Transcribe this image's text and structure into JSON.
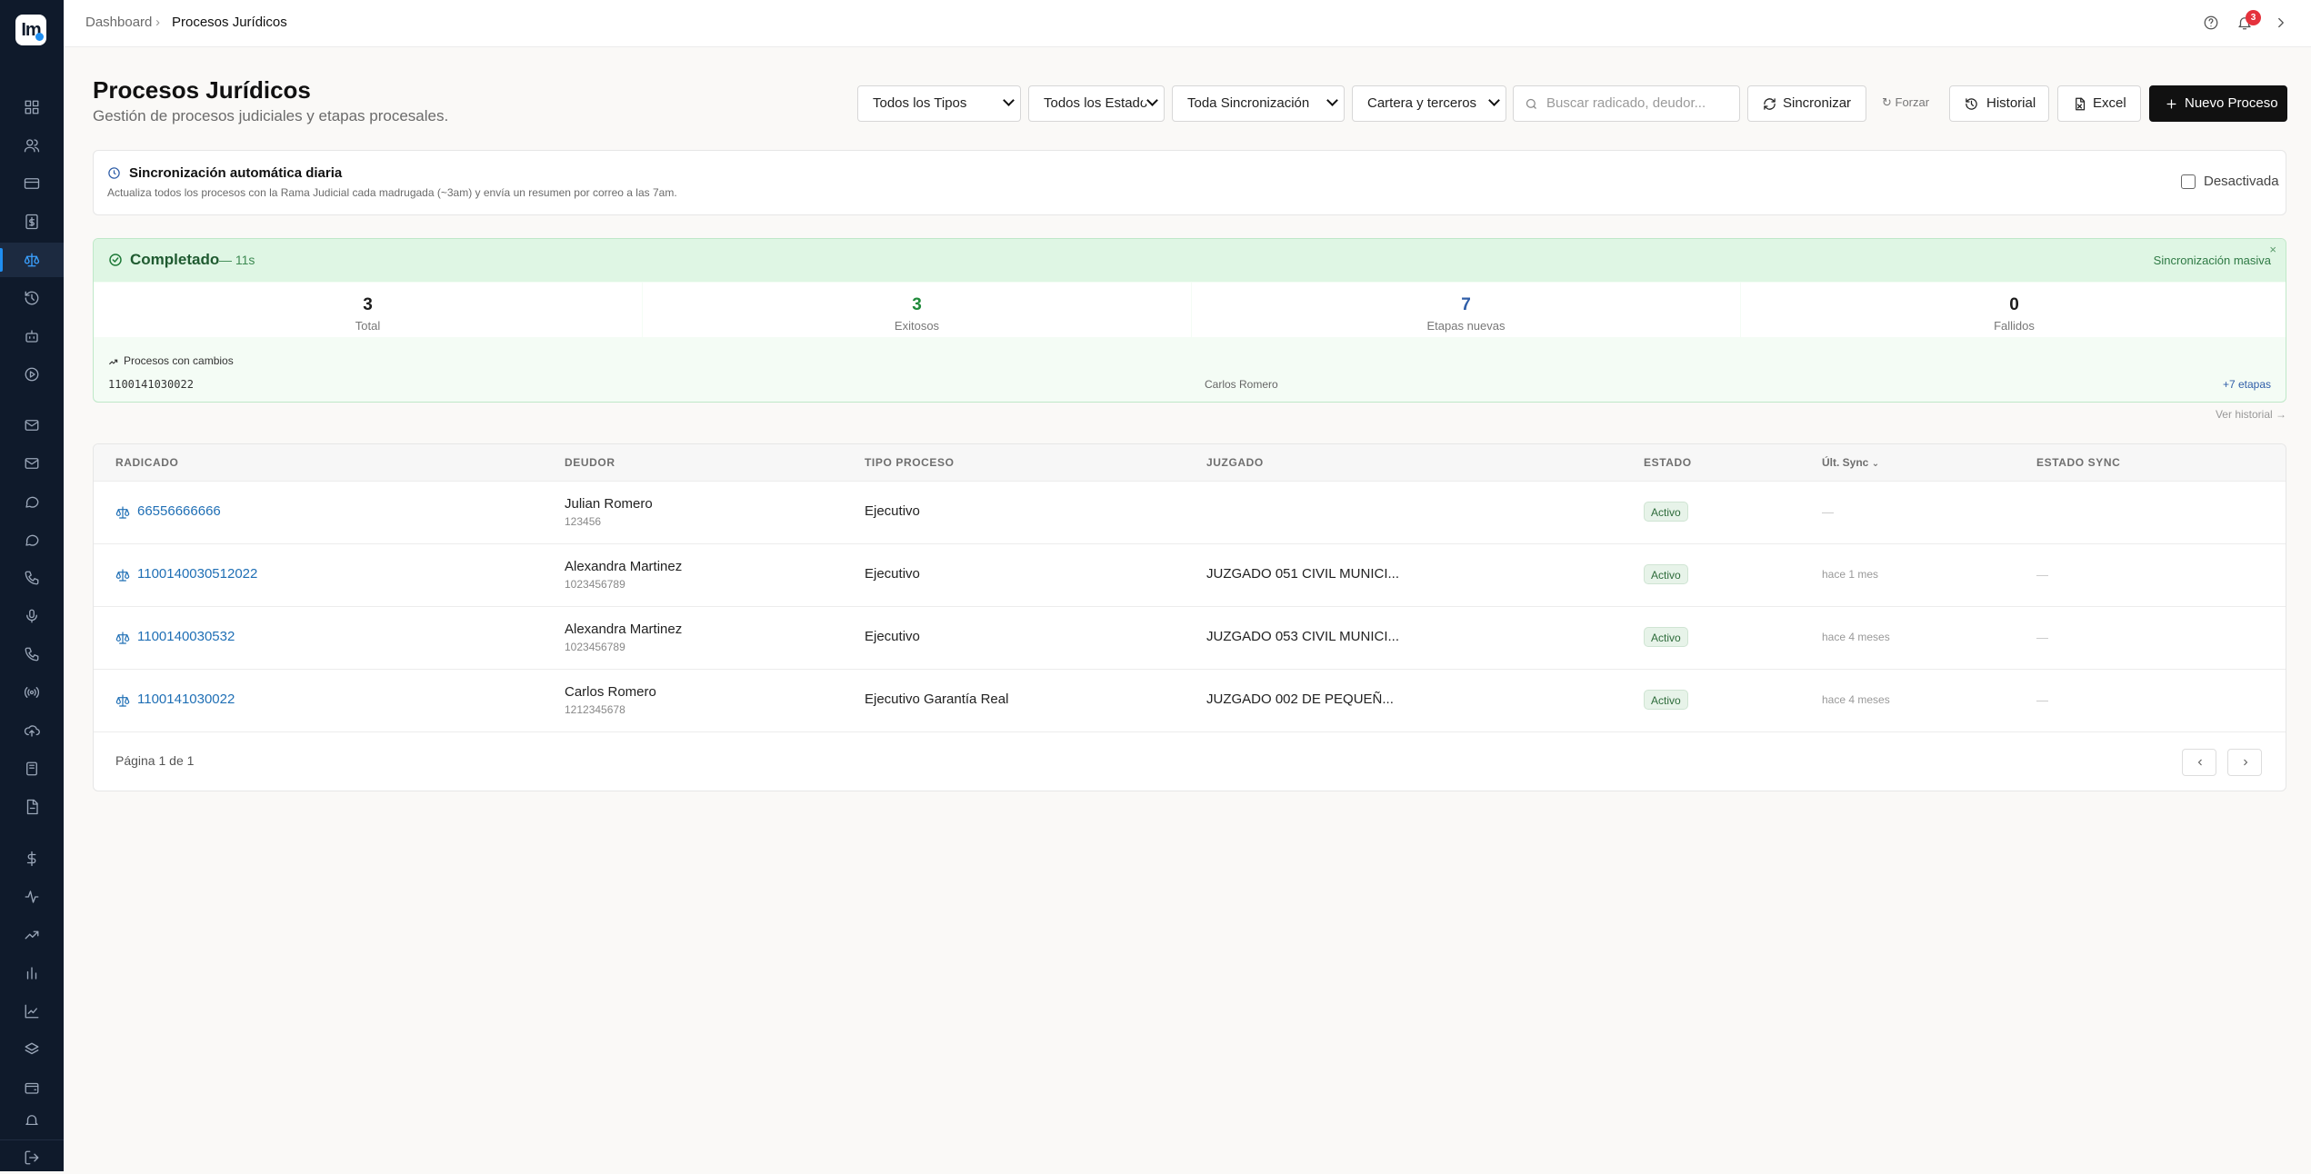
{
  "app": {
    "logo_text": "Im"
  },
  "breadcrumb": {
    "parent": "Dashboard",
    "separator": "›",
    "current": "Procesos Jurídicos"
  },
  "notifications": {
    "count": "3"
  },
  "header": {
    "title": "Procesos Jurídicos",
    "subtitle": "Gestión de procesos judiciales y etapas procesales."
  },
  "filters": {
    "tipo": "Todos los Tipos",
    "estado": "Todos los Estado",
    "sincronizacion": "Toda Sincronización",
    "cartera": "Cartera y terceros",
    "search_placeholder": "Buscar radicado, deudor..."
  },
  "actions": {
    "sync": "Sincronizar",
    "force": "↻ Forzar",
    "history": "Historial",
    "excel": "Excel",
    "new": "Nuevo Proceso"
  },
  "autosync": {
    "title": "Sincronización automática diaria",
    "description": "Actualiza todos los procesos con la Rama Judicial cada madrugada (~3am) y envía un resumen por correo a las 7am.",
    "toggle_label": "Desactivada"
  },
  "sync_result": {
    "status": "Completado",
    "duration": "— 11s",
    "mode": "Sincronización masiva",
    "stats": [
      {
        "value": "3",
        "label": "Total",
        "color": "#111111"
      },
      {
        "value": "3",
        "label": "Exitosos",
        "color": "#1f8a3a"
      },
      {
        "value": "7",
        "label": "Etapas nuevas",
        "color": "#2f5ea8"
      },
      {
        "value": "0",
        "label": "Fallidos",
        "color": "#111111"
      }
    ],
    "changes_title": "Procesos con cambios",
    "changes": [
      {
        "radicado": "1100141030022",
        "deudor": "Carlos Romero",
        "etapas": "+7 etapas"
      }
    ],
    "history_link": "Ver historial →"
  },
  "table": {
    "columns": [
      "RADICADO",
      "DEUDOR",
      "TIPO PROCESO",
      "JUZGADO",
      "ESTADO",
      "Últ. Sync",
      "ESTADO SYNC"
    ],
    "rows": [
      {
        "radicado": "66556666666",
        "deudor": "Julian Romero",
        "doc": "123456",
        "tipo": "Ejecutivo",
        "juzgado": "",
        "estado": "Activo",
        "ult_sync": "—",
        "estado_sync": ""
      },
      {
        "radicado": "1100140030512022",
        "deudor": "Alexandra Martinez",
        "doc": "1023456789",
        "tipo": "Ejecutivo",
        "juzgado": "JUZGADO 051 CIVIL MUNICI...",
        "estado": "Activo",
        "ult_sync": "hace 1 mes",
        "estado_sync": "—"
      },
      {
        "radicado": "1100140030532",
        "deudor": "Alexandra Martinez",
        "doc": "1023456789",
        "tipo": "Ejecutivo",
        "juzgado": "JUZGADO 053 CIVIL MUNICI...",
        "estado": "Activo",
        "ult_sync": "hace 4 meses",
        "estado_sync": "—"
      },
      {
        "radicado": "1100141030022",
        "deudor": "Carlos Romero",
        "doc": "1212345678",
        "tipo": "Ejecutivo Garantía Real",
        "juzgado": "JUZGADO 002 DE PEQUEÑ...",
        "estado": "Activo",
        "ult_sync": "hace 4 meses",
        "estado_sync": "—"
      }
    ]
  },
  "pagination": {
    "label": "Página 1 de 1"
  }
}
